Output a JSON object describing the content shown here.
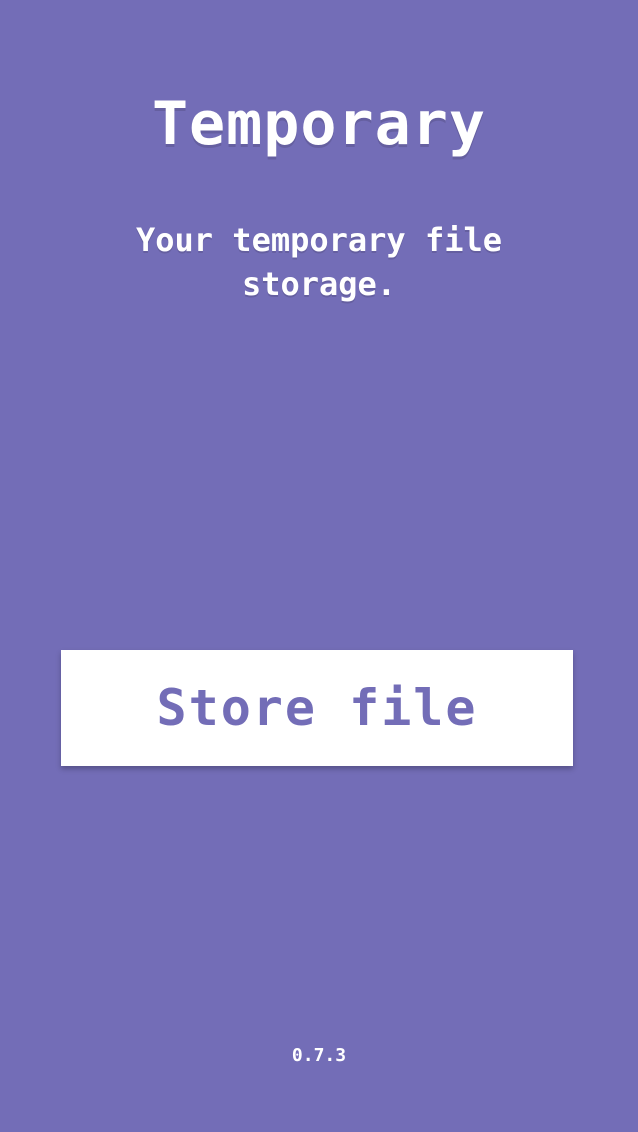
{
  "app": {
    "title": "Temporary",
    "subtitle": "Your temporary file storage.",
    "version": "0.7.3"
  },
  "actions": {
    "store_label": "Store file"
  },
  "colors": {
    "background": "#736db7",
    "button_background": "#ffffff",
    "button_text": "#736db7",
    "text": "#ffffff"
  }
}
